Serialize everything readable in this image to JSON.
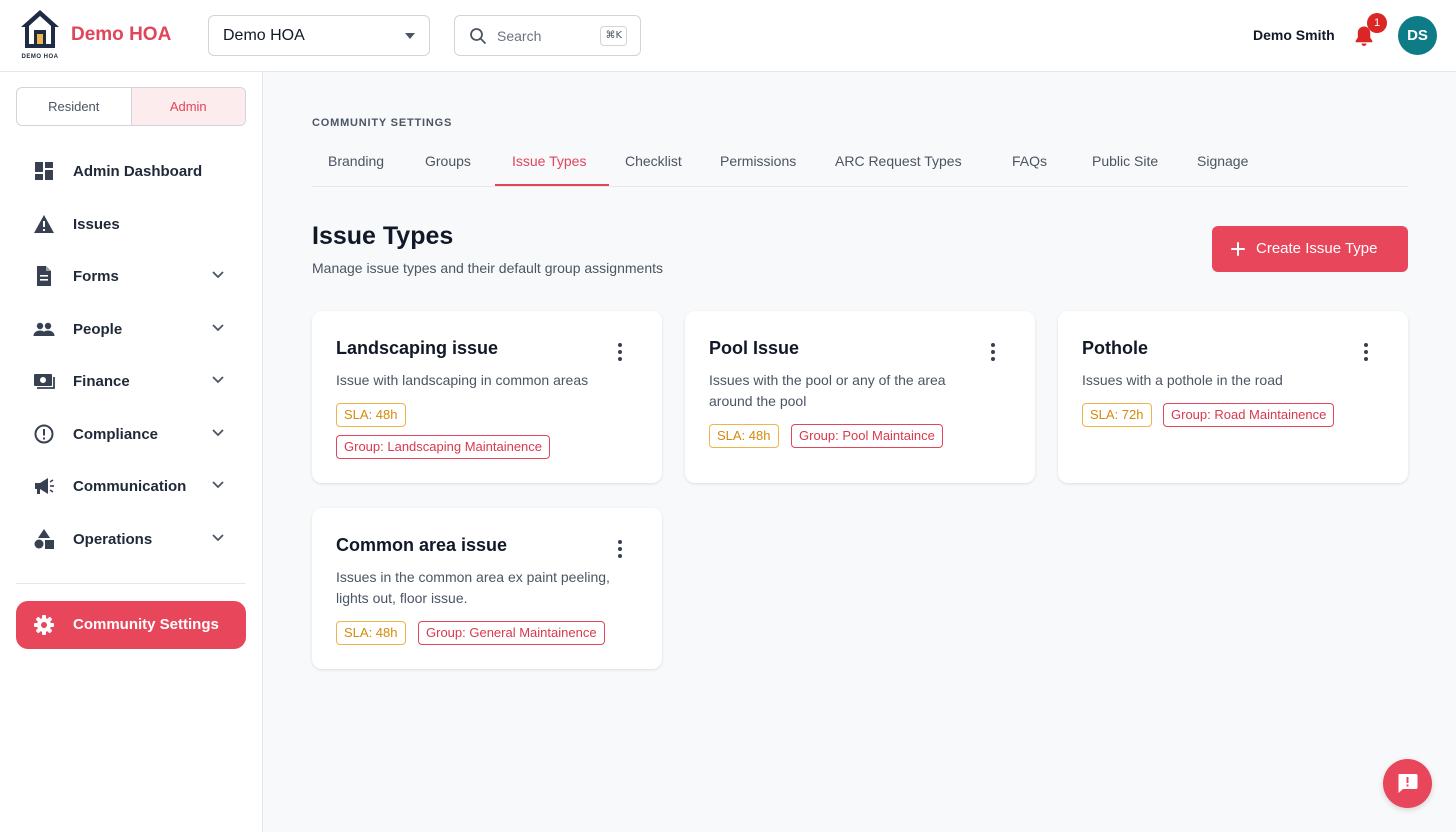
{
  "header": {
    "logo_caption": "DEMO HOA",
    "brand": "Demo HOA",
    "hoa_select_value": "Demo HOA",
    "search_placeholder": "Search",
    "search_shortcut": "⌘K",
    "user_name": "Demo Smith",
    "notification_count": "1",
    "avatar_initials": "DS"
  },
  "sidebar": {
    "role_toggle": [
      "Resident",
      "Admin"
    ],
    "active_role": "Admin",
    "items": [
      {
        "label": "Admin Dashboard",
        "icon": "dashboard-icon",
        "expandable": false
      },
      {
        "label": "Issues",
        "icon": "warning-icon",
        "expandable": false
      },
      {
        "label": "Forms",
        "icon": "document-icon",
        "expandable": true
      },
      {
        "label": "People",
        "icon": "people-icon",
        "expandable": true
      },
      {
        "label": "Finance",
        "icon": "money-icon",
        "expandable": true
      },
      {
        "label": "Compliance",
        "icon": "alert-circle-icon",
        "expandable": true
      },
      {
        "label": "Communication",
        "icon": "megaphone-icon",
        "expandable": true
      },
      {
        "label": "Operations",
        "icon": "shapes-icon",
        "expandable": true
      }
    ],
    "settings_label": "Community Settings"
  },
  "main": {
    "section_caption": "COMMUNITY SETTINGS",
    "tabs": [
      "Branding",
      "Groups",
      "Issue Types",
      "Checklist",
      "Permissions",
      "ARC Request Types",
      "FAQs",
      "Public Site",
      "Signage"
    ],
    "active_tab": "Issue Types",
    "title": "Issue Types",
    "subtitle": "Manage issue types and their default group assignments",
    "create_button": "Create Issue Type",
    "cards": [
      {
        "title": "Landscaping issue",
        "description": "Issue with landscaping in common areas",
        "sla": "SLA: 48h",
        "group": "Group: Landscaping Maintainence"
      },
      {
        "title": "Pool Issue",
        "description": "Issues with the pool or any of the area around the pool",
        "sla": "SLA: 48h",
        "group": "Group: Pool Maintaince"
      },
      {
        "title": "Pothole",
        "description": "Issues with a pothole in the road",
        "sla": "SLA: 72h",
        "group": "Group: Road Maintainence"
      },
      {
        "title": "Common area issue",
        "description": "Issues in the common area ex paint peeling, lights out, floor issue.",
        "sla": "SLA: 48h",
        "group": "Group: General Maintainence"
      }
    ]
  },
  "colors": {
    "accent": "#e8465a",
    "avatar": "#0e7c86",
    "sla_tag": "#f0b44c",
    "notification_badge": "#dc2626"
  }
}
